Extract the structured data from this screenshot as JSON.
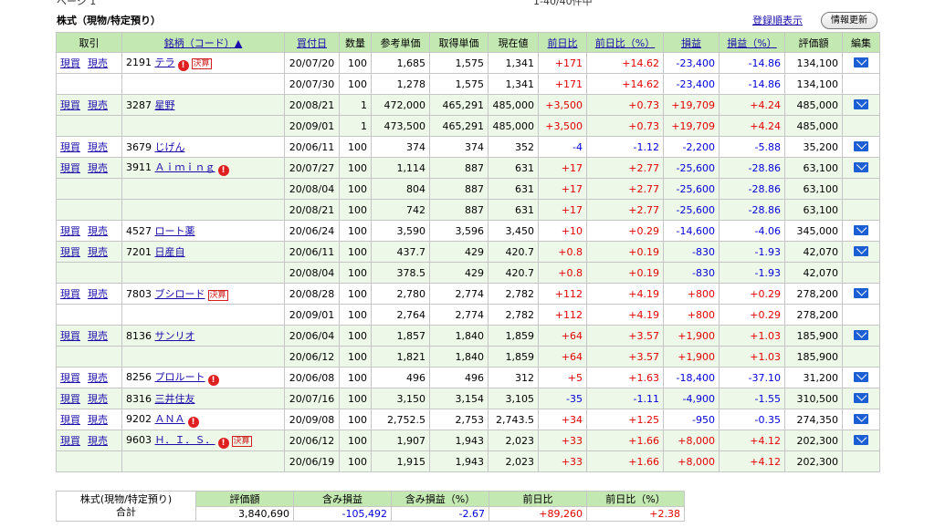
{
  "header": {
    "page": "ページ 1",
    "count": "1-40/40件中",
    "title": "株式（現物/特定預り）",
    "sort_link": "登録順表示",
    "refresh_button": "情報更新"
  },
  "columns": [
    "取引",
    "銘柄（コード）▲",
    "買付日",
    "数量",
    "参考単価",
    "取得単価",
    "現在値",
    "前日比",
    "前日比（%）",
    "損益",
    "損益（%）",
    "評価額",
    "編集"
  ],
  "actions": {
    "buy": "現買",
    "sell": "現売"
  },
  "badge_kessan": "決算",
  "alert_mark": "!",
  "holdings": [
    {
      "code": "2191",
      "name": "テラ",
      "alert": true,
      "kessan": true,
      "rows": [
        {
          "date": "20/07/20",
          "qty": "100",
          "ref": "1,685",
          "cost": "1,575",
          "price": "1,341",
          "chg": "+171",
          "chgp": "+14.62",
          "pl": "-23,400",
          "plp": "-14.86",
          "val": "134,100"
        },
        {
          "date": "20/07/30",
          "qty": "100",
          "ref": "1,278",
          "cost": "1,575",
          "price": "1,341",
          "chg": "+171",
          "chgp": "+14.62",
          "pl": "-23,400",
          "plp": "-14.86",
          "val": "134,100"
        }
      ]
    },
    {
      "code": "3287",
      "name": "星野",
      "alert": false,
      "kessan": false,
      "rows": [
        {
          "date": "20/08/21",
          "qty": "1",
          "ref": "472,000",
          "cost": "465,291",
          "price": "485,000",
          "chg": "+3,500",
          "chgp": "+0.73",
          "pl": "+19,709",
          "plp": "+4.24",
          "val": "485,000"
        },
        {
          "date": "20/09/01",
          "qty": "1",
          "ref": "473,500",
          "cost": "465,291",
          "price": "485,000",
          "chg": "+3,500",
          "chgp": "+0.73",
          "pl": "+19,709",
          "plp": "+4.24",
          "val": "485,000"
        }
      ]
    },
    {
      "code": "3679",
      "name": "じげん",
      "alert": false,
      "kessan": false,
      "rows": [
        {
          "date": "20/06/11",
          "qty": "100",
          "ref": "374",
          "cost": "374",
          "price": "352",
          "chg": "-4",
          "chgp": "-1.12",
          "pl": "-2,200",
          "plp": "-5.88",
          "val": "35,200"
        }
      ]
    },
    {
      "code": "3911",
      "name": "Ａｉｍｉｎｇ",
      "alert": true,
      "kessan": false,
      "rows": [
        {
          "date": "20/07/27",
          "qty": "100",
          "ref": "1,114",
          "cost": "887",
          "price": "631",
          "chg": "+17",
          "chgp": "+2.77",
          "pl": "-25,600",
          "plp": "-28.86",
          "val": "63,100"
        },
        {
          "date": "20/08/04",
          "qty": "100",
          "ref": "804",
          "cost": "887",
          "price": "631",
          "chg": "+17",
          "chgp": "+2.77",
          "pl": "-25,600",
          "plp": "-28.86",
          "val": "63,100"
        },
        {
          "date": "20/08/21",
          "qty": "100",
          "ref": "742",
          "cost": "887",
          "price": "631",
          "chg": "+17",
          "chgp": "+2.77",
          "pl": "-25,600",
          "plp": "-28.86",
          "val": "63,100"
        }
      ]
    },
    {
      "code": "4527",
      "name": "ロート薬",
      "alert": false,
      "kessan": false,
      "rows": [
        {
          "date": "20/06/24",
          "qty": "100",
          "ref": "3,590",
          "cost": "3,596",
          "price": "3,450",
          "chg": "+10",
          "chgp": "+0.29",
          "pl": "-14,600",
          "plp": "-4.06",
          "val": "345,000"
        }
      ]
    },
    {
      "code": "7201",
      "name": "日産自",
      "alert": false,
      "kessan": false,
      "rows": [
        {
          "date": "20/06/11",
          "qty": "100",
          "ref": "437.7",
          "cost": "429",
          "price": "420.7",
          "chg": "+0.8",
          "chgp": "+0.19",
          "pl": "-830",
          "plp": "-1.93",
          "val": "42,070"
        },
        {
          "date": "20/08/04",
          "qty": "100",
          "ref": "378.5",
          "cost": "429",
          "price": "420.7",
          "chg": "+0.8",
          "chgp": "+0.19",
          "pl": "-830",
          "plp": "-1.93",
          "val": "42,070"
        }
      ]
    },
    {
      "code": "7803",
      "name": "ブシロード",
      "alert": false,
      "kessan": true,
      "rows": [
        {
          "date": "20/08/28",
          "qty": "100",
          "ref": "2,780",
          "cost": "2,774",
          "price": "2,782",
          "chg": "+112",
          "chgp": "+4.19",
          "pl": "+800",
          "plp": "+0.29",
          "val": "278,200"
        },
        {
          "date": "20/09/01",
          "qty": "100",
          "ref": "2,764",
          "cost": "2,774",
          "price": "2,782",
          "chg": "+112",
          "chgp": "+4.19",
          "pl": "+800",
          "plp": "+0.29",
          "val": "278,200"
        }
      ]
    },
    {
      "code": "8136",
      "name": "サンリオ",
      "alert": false,
      "kessan": false,
      "rows": [
        {
          "date": "20/06/04",
          "qty": "100",
          "ref": "1,857",
          "cost": "1,840",
          "price": "1,859",
          "chg": "+64",
          "chgp": "+3.57",
          "pl": "+1,900",
          "plp": "+1.03",
          "val": "185,900"
        },
        {
          "date": "20/06/12",
          "qty": "100",
          "ref": "1,821",
          "cost": "1,840",
          "price": "1,859",
          "chg": "+64",
          "chgp": "+3.57",
          "pl": "+1,900",
          "plp": "+1.03",
          "val": "185,900"
        }
      ]
    },
    {
      "code": "8256",
      "name": "プロルート",
      "alert": true,
      "kessan": false,
      "rows": [
        {
          "date": "20/06/08",
          "qty": "100",
          "ref": "496",
          "cost": "496",
          "price": "312",
          "chg": "+5",
          "chgp": "+1.63",
          "pl": "-18,400",
          "plp": "-37.10",
          "val": "31,200"
        }
      ]
    },
    {
      "code": "8316",
      "name": "三井住友",
      "alert": false,
      "kessan": false,
      "rows": [
        {
          "date": "20/07/16",
          "qty": "100",
          "ref": "3,150",
          "cost": "3,154",
          "price": "3,105",
          "chg": "-35",
          "chgp": "-1.11",
          "pl": "-4,900",
          "plp": "-1.55",
          "val": "310,500"
        }
      ]
    },
    {
      "code": "9202",
      "name": "ＡＮＡ",
      "alert": true,
      "kessan": false,
      "rows": [
        {
          "date": "20/09/08",
          "qty": "100",
          "ref": "2,752.5",
          "cost": "2,753",
          "price": "2,743.5",
          "chg": "+34",
          "chgp": "+1.25",
          "pl": "-950",
          "plp": "-0.35",
          "val": "274,350"
        }
      ]
    },
    {
      "code": "9603",
      "name": "Ｈ．Ｉ．Ｓ．",
      "alert": true,
      "kessan": true,
      "rows": [
        {
          "date": "20/06/12",
          "qty": "100",
          "ref": "1,907",
          "cost": "1,943",
          "price": "2,023",
          "chg": "+33",
          "chgp": "+1.66",
          "pl": "+8,000",
          "plp": "+4.12",
          "val": "202,300"
        },
        {
          "date": "20/06/19",
          "qty": "100",
          "ref": "1,915",
          "cost": "1,943",
          "price": "2,023",
          "chg": "+33",
          "chgp": "+1.66",
          "pl": "+8,000",
          "plp": "+4.12",
          "val": "202,300"
        }
      ]
    }
  ],
  "summary": {
    "label": "株式(現物/特定預り)",
    "label2": "合計",
    "headers": [
      "評価額",
      "含み損益",
      "含み損益（%）",
      "前日比",
      "前日比（%）"
    ],
    "values": [
      "3,840,690",
      "-105,492",
      "-2.67",
      "+89,260",
      "+2.38"
    ]
  },
  "colors": {
    "positive": "#e60000",
    "negative": "#0000dd",
    "header_bg": "#c4e8b2",
    "shaded_row": "#eef8e8",
    "link": "#1a0dab"
  }
}
